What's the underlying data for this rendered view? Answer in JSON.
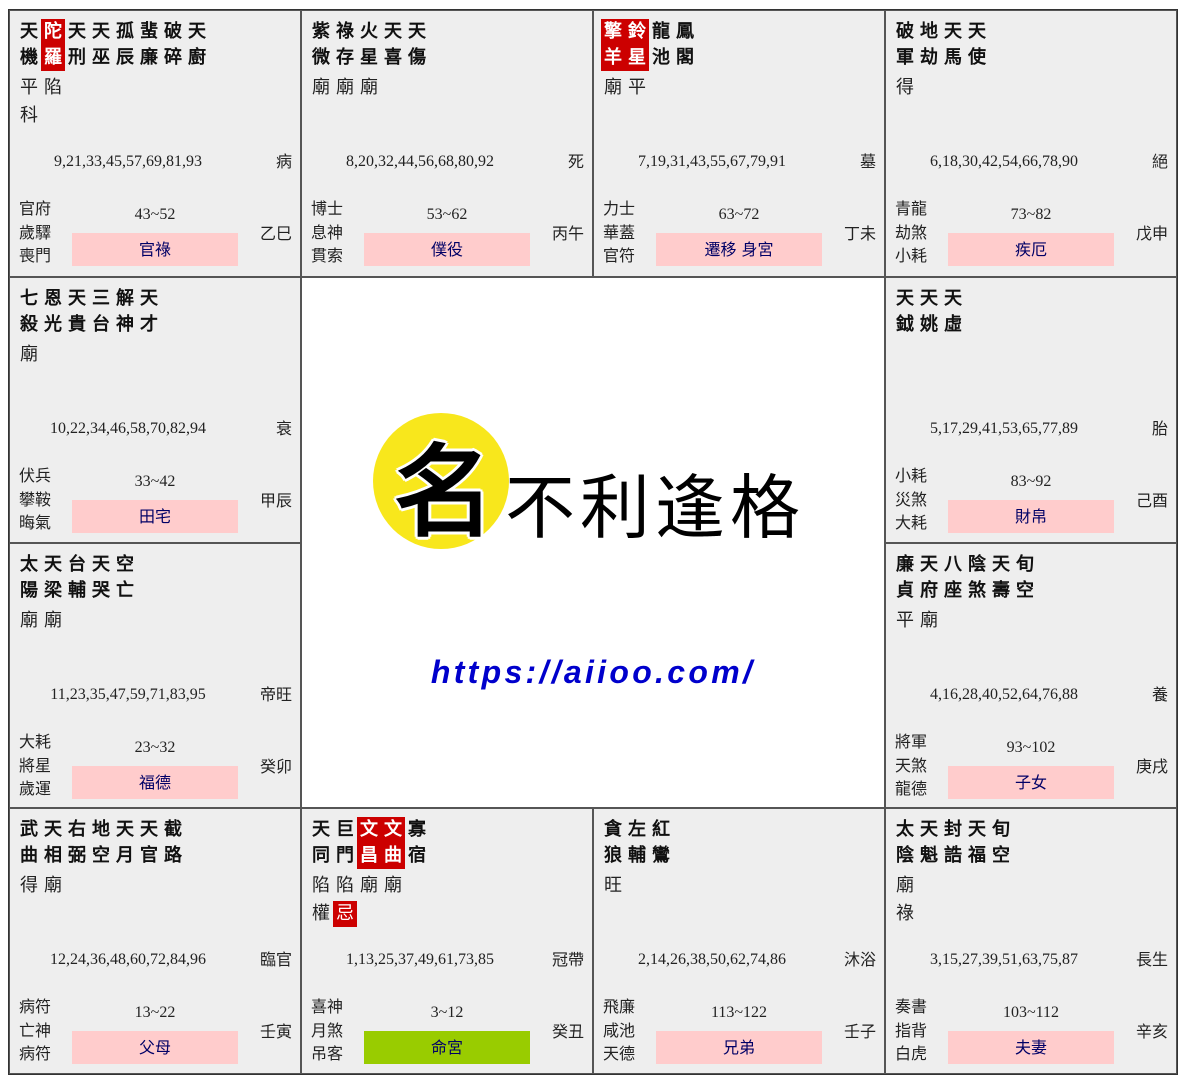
{
  "colors": {
    "cell_background": "#eeeeee",
    "highlight": "#cc0000",
    "palace_badge": "#ffcccc",
    "ming_badge": "#99cc00",
    "palace_text": "#000066",
    "logo_yellow": "#f8e71c",
    "url": "#0000cc"
  },
  "palaces": [
    {
      "stem_branch": "乙巳",
      "palace": "官祿",
      "decade_range": "43~52",
      "life_stage": "病",
      "ages": "9,21,33,45,57,69,81,93",
      "gods": [
        "官府",
        "歲驛",
        "喪門"
      ],
      "stars": [
        {
          "name": "天機",
          "brightness": "平",
          "transformation": "科"
        },
        {
          "name": "陀羅",
          "brightness": "陷",
          "highlight": true
        },
        {
          "name": "天刑"
        },
        {
          "name": "天巫"
        },
        {
          "name": "孤辰"
        },
        {
          "name": "蜚廉"
        },
        {
          "name": "破碎"
        },
        {
          "name": "天廚"
        }
      ]
    },
    {
      "stem_branch": "丙午",
      "palace": "僕役",
      "decade_range": "53~62",
      "life_stage": "死",
      "ages": "8,20,32,44,56,68,80,92",
      "gods": [
        "博士",
        "息神",
        "貫索"
      ],
      "stars": [
        {
          "name": "紫微",
          "brightness": "廟"
        },
        {
          "name": "祿存",
          "brightness": "廟"
        },
        {
          "name": "火星",
          "brightness": "廟"
        },
        {
          "name": "天喜"
        },
        {
          "name": "天傷"
        }
      ]
    },
    {
      "stem_branch": "丁未",
      "palace": "遷移 身宮",
      "decade_range": "63~72",
      "life_stage": "墓",
      "ages": "7,19,31,43,55,67,79,91",
      "gods": [
        "力士",
        "華蓋",
        "官符"
      ],
      "stars": [
        {
          "name": "擎羊",
          "brightness": "廟",
          "highlight": true
        },
        {
          "name": "鈴星",
          "brightness": "平",
          "highlight": true
        },
        {
          "name": "龍池"
        },
        {
          "name": "鳳閣"
        }
      ]
    },
    {
      "stem_branch": "戊申",
      "palace": "疾厄",
      "decade_range": "73~82",
      "life_stage": "絕",
      "ages": "6,18,30,42,54,66,78,90",
      "gods": [
        "青龍",
        "劫煞",
        "小耗"
      ],
      "stars": [
        {
          "name": "破軍",
          "brightness": "得"
        },
        {
          "name": "地劫"
        },
        {
          "name": "天馬"
        },
        {
          "name": "天使"
        }
      ]
    },
    {
      "stem_branch": "甲辰",
      "palace": "田宅",
      "decade_range": "33~42",
      "life_stage": "衰",
      "ages": "10,22,34,46,58,70,82,94",
      "gods": [
        "伏兵",
        "攀鞍",
        "晦氣"
      ],
      "stars": [
        {
          "name": "七殺",
          "brightness": "廟"
        },
        {
          "name": "恩光"
        },
        {
          "name": "天貴"
        },
        {
          "name": "三台"
        },
        {
          "name": "解神"
        },
        {
          "name": "天才"
        }
      ]
    },
    {
      "stem_branch": "己酉",
      "palace": "財帛",
      "decade_range": "83~92",
      "life_stage": "胎",
      "ages": "5,17,29,41,53,65,77,89",
      "gods": [
        "小耗",
        "災煞",
        "大耗"
      ],
      "stars": [
        {
          "name": "天鉞"
        },
        {
          "name": "天姚"
        },
        {
          "name": "天虛"
        }
      ]
    },
    {
      "stem_branch": "癸卯",
      "palace": "福德",
      "decade_range": "23~32",
      "life_stage": "帝旺",
      "ages": "11,23,35,47,59,71,83,95",
      "gods": [
        "大耗",
        "將星",
        "歲運"
      ],
      "stars": [
        {
          "name": "太陽",
          "brightness": "廟"
        },
        {
          "name": "天梁",
          "brightness": "廟"
        },
        {
          "name": "台輔"
        },
        {
          "name": "天哭"
        },
        {
          "name": "空亡"
        }
      ]
    },
    {
      "stem_branch": "庚戌",
      "palace": "子女",
      "decade_range": "93~102",
      "life_stage": "養",
      "ages": "4,16,28,40,52,64,76,88",
      "gods": [
        "將軍",
        "天煞",
        "龍德"
      ],
      "stars": [
        {
          "name": "廉貞",
          "brightness": "平"
        },
        {
          "name": "天府",
          "brightness": "廟"
        },
        {
          "name": "八座"
        },
        {
          "name": "陰煞"
        },
        {
          "name": "天壽"
        },
        {
          "name": "旬空"
        }
      ]
    },
    {
      "stem_branch": "壬寅",
      "palace": "父母",
      "decade_range": "13~22",
      "life_stage": "臨官",
      "ages": "12,24,36,48,60,72,84,96",
      "gods": [
        "病符",
        "亡神",
        "病符"
      ],
      "stars": [
        {
          "name": "武曲",
          "brightness": "得"
        },
        {
          "name": "天相",
          "brightness": "廟"
        },
        {
          "name": "右弼"
        },
        {
          "name": "地空"
        },
        {
          "name": "天月"
        },
        {
          "name": "天官"
        },
        {
          "name": "截路"
        }
      ]
    },
    {
      "stem_branch": "癸丑",
      "palace": "命宮",
      "decade_range": "3~12",
      "life_stage": "冠帶",
      "is_ming": true,
      "ages": "1,13,25,37,49,61,73,85",
      "gods": [
        "喜神",
        "月煞",
        "吊客"
      ],
      "stars": [
        {
          "name": "天同",
          "brightness": "陷",
          "transformation": "權"
        },
        {
          "name": "巨門",
          "brightness": "陷",
          "transformation": "忌",
          "hua_highlight": true
        },
        {
          "name": "文昌",
          "brightness": "廟",
          "highlight": true
        },
        {
          "name": "文曲",
          "brightness": "廟",
          "highlight": true
        },
        {
          "name": "寡宿"
        }
      ]
    },
    {
      "stem_branch": "壬子",
      "palace": "兄弟",
      "decade_range": "113~122",
      "life_stage": "沐浴",
      "ages": "2,14,26,38,50,62,74,86",
      "gods": [
        "飛廉",
        "咸池",
        "天德"
      ],
      "stars": [
        {
          "name": "貪狼",
          "brightness": "旺"
        },
        {
          "name": "左輔"
        },
        {
          "name": "紅鸞"
        }
      ]
    },
    {
      "stem_branch": "辛亥",
      "palace": "夫妻",
      "decade_range": "103~112",
      "life_stage": "長生",
      "ages": "3,15,27,39,51,63,75,87",
      "gods": [
        "奏書",
        "指背",
        "白虎"
      ],
      "stars": [
        {
          "name": "太陰",
          "brightness": "廟",
          "transformation": "祿"
        },
        {
          "name": "天魁"
        },
        {
          "name": "封誥"
        },
        {
          "name": "天福"
        },
        {
          "name": "旬空"
        }
      ]
    }
  ],
  "center": {
    "logo_badge_char": "名",
    "logo_text": "不利逢格",
    "url": "https://aiioo.com/"
  }
}
